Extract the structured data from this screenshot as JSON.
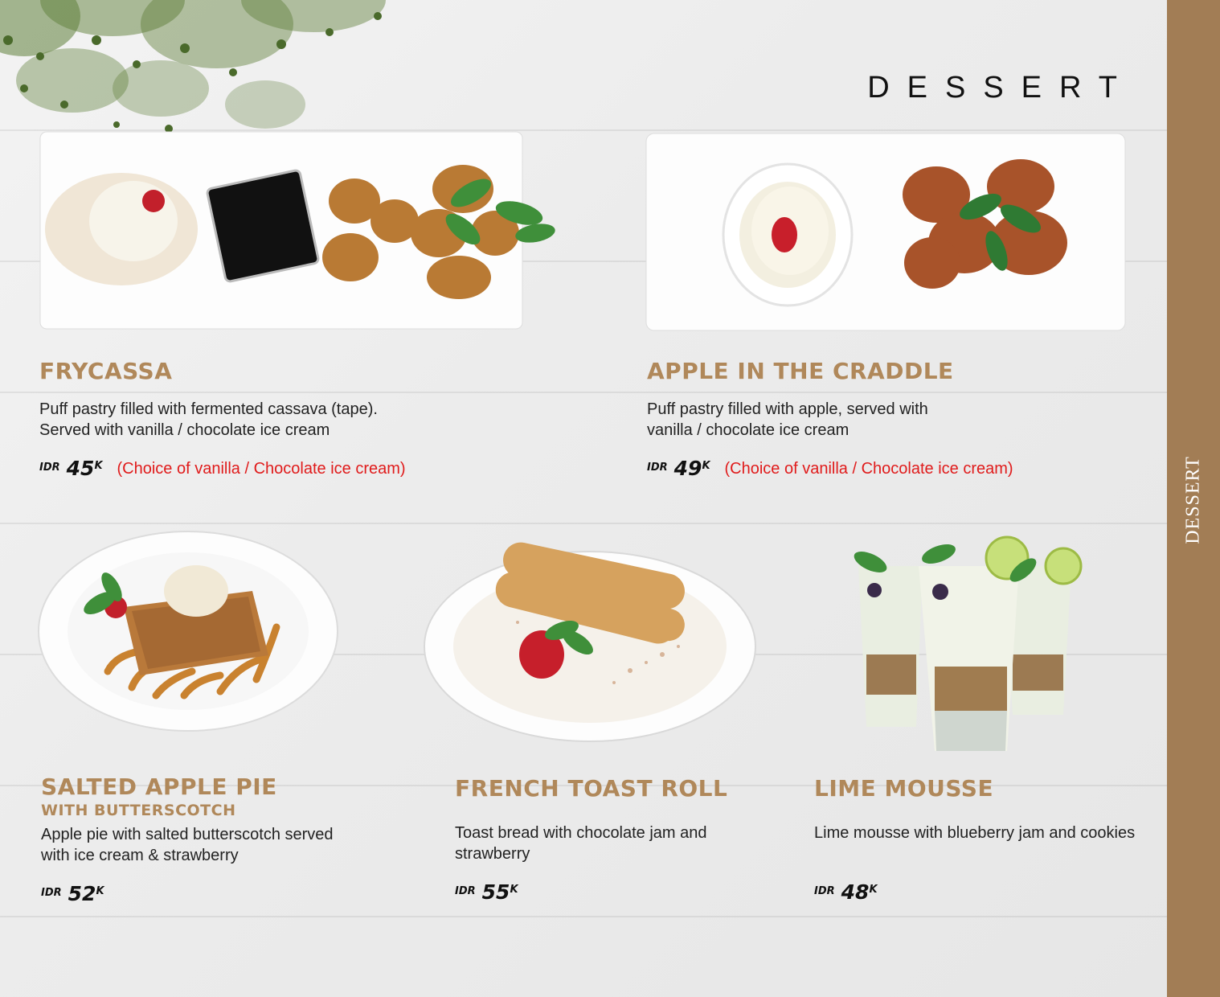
{
  "section": {
    "title": "DESSERT",
    "side_label": "DESSERT"
  },
  "items": [
    {
      "name": "FRYCASSA",
      "description": "Puff pastry filled with fermented cassava (tape).\nServed with vanilla / chocolate ice cream",
      "currency": "IDR",
      "amount": "45",
      "unit": "K",
      "note": "(Choice of vanilla / Chocolate ice cream)"
    },
    {
      "name": "APPLE IN THE CRADDLE",
      "description": "Puff pastry filled with apple, served with\nvanilla / chocolate ice cream",
      "currency": "IDR",
      "amount": "49",
      "unit": "K",
      "note": "(Choice of vanilla / Chocolate ice cream)"
    },
    {
      "name": "SALTED APPLE PIE",
      "subname": "WITH BUTTERSCOTCH",
      "description": "Apple pie with salted butterscotch served\nwith ice cream & strawberry",
      "currency": "IDR",
      "amount": "52",
      "unit": "K"
    },
    {
      "name": "FRENCH TOAST ROLL",
      "description": "Toast bread with chocolate jam and\nstrawberry",
      "currency": "IDR",
      "amount": "55",
      "unit": "K"
    },
    {
      "name": "LIME MOUSSE",
      "description": "Lime mousse with blueberry jam and cookies",
      "currency": "IDR",
      "amount": "48",
      "unit": "K"
    }
  ],
  "colors": {
    "accent_gold": "#b0885a",
    "side_tab": "#a27d55",
    "note_red": "#e01b1b"
  }
}
